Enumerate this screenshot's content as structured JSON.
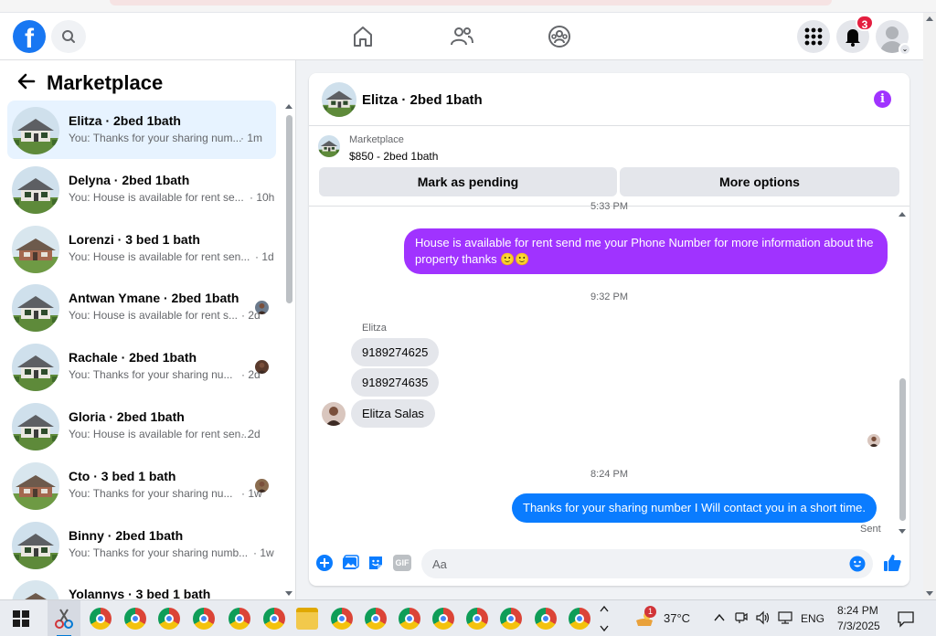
{
  "header": {
    "brand_letter": "f",
    "notification_count": "3"
  },
  "sidebar": {
    "title": "Marketplace",
    "items": [
      {
        "name": "Elitza · 2bed 1bath",
        "preview": "You: Thanks for your sharing num...",
        "time": "· 1m",
        "active": true
      },
      {
        "name": "Delyna · 2bed 1bath",
        "preview": "You: House is available for rent se...",
        "time": "· 10h",
        "active": false
      },
      {
        "name": "Lorenzi · 3 bed 1 bath",
        "preview": "You: House is available for rent sen...",
        "time": "· 1d",
        "active": false
      },
      {
        "name": "Antwan Ymane · 2bed 1bath",
        "preview": "You: House is available for rent s...",
        "time": "· 2d",
        "active": false
      },
      {
        "name": "Rachale · 2bed 1bath",
        "preview": "You: Thanks for your sharing nu...",
        "time": "· 2d",
        "active": false
      },
      {
        "name": "Gloria · 2bed 1bath",
        "preview": "You: House is available for rent sen...",
        "time": "· 2d",
        "active": false
      },
      {
        "name": "Cto · 3 bed 1 bath",
        "preview": "You: Thanks for your sharing nu...",
        "time": "· 1w",
        "active": false
      },
      {
        "name": "Binny · 2bed 1bath",
        "preview": "You: Thanks for your sharing numb...",
        "time": "· 1w",
        "active": false
      },
      {
        "name": "Yolannys · 3 bed 1 bath",
        "preview": "",
        "time": "",
        "active": false
      }
    ]
  },
  "chat": {
    "title": "Elitza · 2bed 1bath",
    "listing_source": "Marketplace",
    "listing_title": "$850 - 2bed 1bath",
    "mark_pending_label": "Mark as pending",
    "more_options_label": "More options",
    "timestamp_top": "5:33 PM",
    "msg_out_1": "House is available for rent send me your Phone Number for more information about the property thanks 🙂🙂",
    "timestamp_mid": "9:32 PM",
    "sender_name": "Elitza",
    "msg_in_1": "9189274625",
    "msg_in_2": "9189274635",
    "msg_in_3": "Elitza Salas",
    "timestamp_bottom": "8:24 PM",
    "msg_out_2": "Thanks for your sharing number I Will contact you in a short time.",
    "sent_status": "Sent",
    "composer_placeholder": "Aa",
    "gif_label": "GIF"
  },
  "taskbar": {
    "weather_temp": "37°C",
    "weather_alert": "1",
    "language": "ENG",
    "time": "8:24 PM",
    "date": "7/3/2025"
  },
  "colors": {
    "fb_blue": "#1877f2",
    "purple_bubble": "#a033ff",
    "blue_bubble": "#0a7cff"
  }
}
